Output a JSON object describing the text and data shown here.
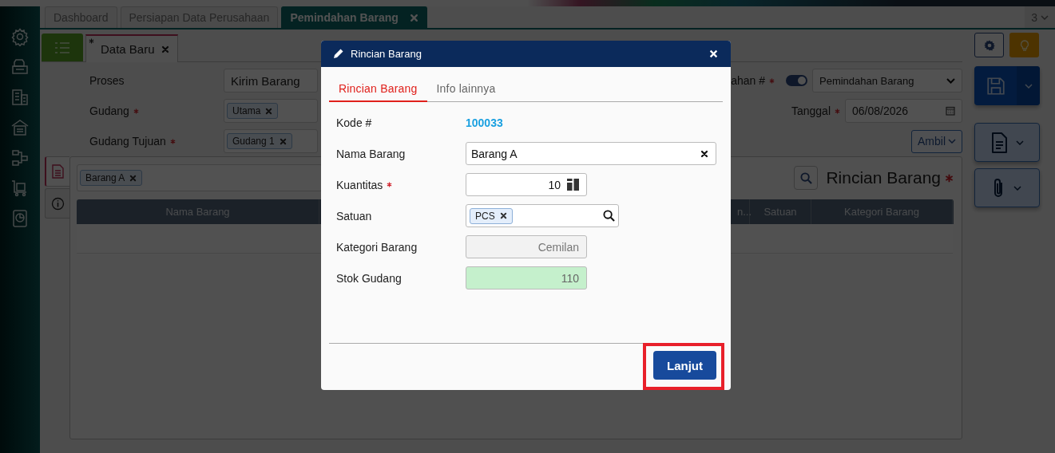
{
  "top_tabs": [
    {
      "label": "Dashboard",
      "selected": false,
      "closable": false
    },
    {
      "label": "Persiapan Data Perusahaan",
      "selected": false,
      "closable": false
    },
    {
      "label": "Pemindahan Barang",
      "selected": true,
      "closable": true
    }
  ],
  "tab_count": "3",
  "sub_tabs": [
    {
      "label": "Data Baru",
      "modified": true,
      "selected": true
    }
  ],
  "form": {
    "left": [
      {
        "label": "Proses",
        "required": false,
        "kind": "text",
        "value": "Kirim Barang"
      },
      {
        "label": "Gudang",
        "required": true,
        "kind": "chips",
        "chips": [
          "Utama"
        ]
      },
      {
        "label": "Gudang Tujuan",
        "required": true,
        "kind": "chips",
        "chips": [
          "Gudang 1"
        ]
      }
    ],
    "right": [
      {
        "label": "ahan #",
        "required": true,
        "kind": "select",
        "toggle_on": true,
        "value": "Pemindahan Barang"
      },
      {
        "label": "Tanggal",
        "required": true,
        "kind": "date",
        "value": "06/08/2026"
      }
    ],
    "fetch_button": "Ambil"
  },
  "side_tabs": [
    {
      "kind": "document",
      "selected": true
    },
    {
      "kind": "info",
      "selected": false
    }
  ],
  "details": {
    "chips": [
      "Barang A"
    ],
    "title": "Rincian Barang",
    "required": true,
    "columns": [
      "Nama Barang",
      "n...",
      "Satuan",
      "Kategori Barang"
    ]
  },
  "modal": {
    "title": "Rincian Barang",
    "tabs": [
      {
        "label": "Rincian Barang",
        "selected": true
      },
      {
        "label": "Info lainnya",
        "selected": false
      }
    ],
    "fields": [
      {
        "label": "Kode #",
        "required": false,
        "kind": "link",
        "value": "100033"
      },
      {
        "label": "Nama Barang",
        "required": false,
        "kind": "clearable",
        "value": "Barang A"
      },
      {
        "label": "Kuantitas",
        "required": true,
        "kind": "number",
        "value": "10"
      },
      {
        "label": "Satuan",
        "required": false,
        "kind": "chips",
        "chips": [
          "PCS"
        ]
      },
      {
        "label": "Kategori Barang",
        "required": false,
        "kind": "readonly",
        "value": "Cemilan"
      },
      {
        "label": "Stok Gudang",
        "required": false,
        "kind": "stock",
        "value": "110"
      }
    ],
    "button": {
      "label": "Lanjut",
      "highlighted": true
    }
  }
}
